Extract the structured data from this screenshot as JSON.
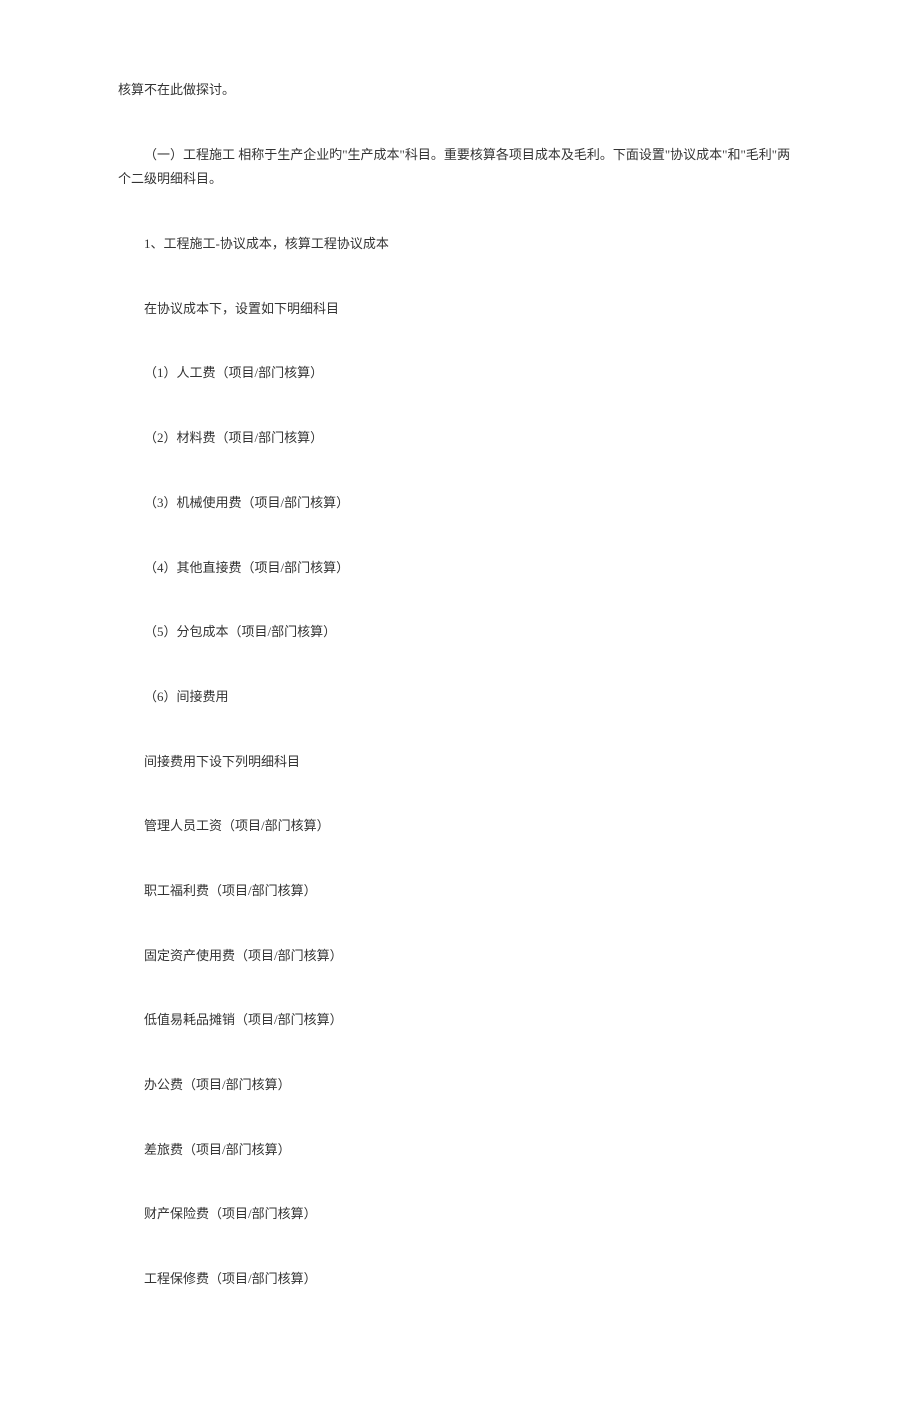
{
  "paragraphs": [
    {
      "text": "核算不在此做探讨。",
      "indent": false
    },
    {
      "text": "（一）工程施工 相称于生产企业旳\"生产成本\"科目。重要核算各项目成本及毛利。下面设置\"协议成本\"和\"毛利\"两个二级明细科目。",
      "indent": true
    },
    {
      "text": "1、工程施工-协议成本，核算工程协议成本",
      "indent": true
    },
    {
      "text": "在协议成本下，设置如下明细科目",
      "indent": true
    },
    {
      "text": "（1）人工费（项目/部门核算）",
      "indent": true
    },
    {
      "text": "（2）材料费（项目/部门核算）",
      "indent": true
    },
    {
      "text": "（3）机械使用费（项目/部门核算）",
      "indent": true
    },
    {
      "text": "（4）其他直接费（项目/部门核算）",
      "indent": true
    },
    {
      "text": "（5）分包成本（项目/部门核算）",
      "indent": true
    },
    {
      "text": "（6）间接费用",
      "indent": true
    },
    {
      "text": "间接费用下设下列明细科目",
      "indent": true
    },
    {
      "text": "管理人员工资（项目/部门核算）",
      "indent": true
    },
    {
      "text": "职工福利费（项目/部门核算）",
      "indent": true
    },
    {
      "text": "固定资产使用费（项目/部门核算）",
      "indent": true
    },
    {
      "text": "低值易耗品摊销（项目/部门核算）",
      "indent": true
    },
    {
      "text": "办公费（项目/部门核算）",
      "indent": true
    },
    {
      "text": "差旅费（项目/部门核算）",
      "indent": true
    },
    {
      "text": "财产保险费（项目/部门核算）",
      "indent": true
    },
    {
      "text": "工程保修费（项目/部门核算）",
      "indent": true
    }
  ]
}
